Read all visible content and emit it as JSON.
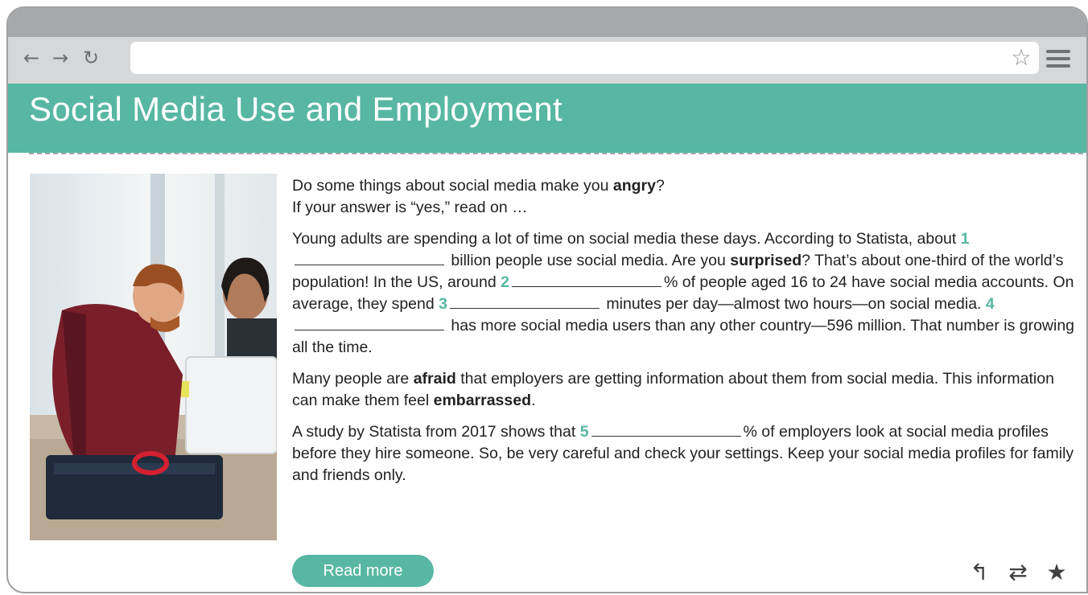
{
  "browser": {
    "back_icon": "←",
    "forward_icon": "→",
    "reload_icon": "↻",
    "address_value": "",
    "bookmark_icon": "☆"
  },
  "page": {
    "title": "Social Media Use and Employment",
    "accent_color": "#57b7a2"
  },
  "article": {
    "intro_pre": "Do some things about social media make you ",
    "intro_bold": "angry",
    "intro_post": "?",
    "intro_line2": "If your answer is “yes,” read on …",
    "p2_a": "Young adults are spending a lot of time on social media these days. According to Statista, about ",
    "num1": "1",
    "p2_b": " billion people use social media. Are you ",
    "p2_bold_surprised": "surprised",
    "p2_c": "? That’s about one-third of the world’s population! In the US, around ",
    "num2": "2",
    "p2_d": "% of people aged 16 to 24 have social media accounts. On average, they spend ",
    "num3": "3",
    "p2_e": " minutes per day—almost two hours—on social media. ",
    "num4": "4",
    "p2_f": " has more social media users than any other country—596 million. That number is growing all the time.",
    "p3_a": "Many people are ",
    "p3_bold_afraid": "afraid",
    "p3_b": " that employers are getting information about them from social media. This information can make them feel ",
    "p3_bold_embarrassed": "embarrassed",
    "p3_c": ".",
    "p4_a": "A study by Statista from 2017 shows that ",
    "num5": "5",
    "p4_b": "% of employers look at social media profiles before they hire someone. So, be very careful and check your settings. Keep your social media profiles for family and friends only."
  },
  "buttons": {
    "read_more": "Read more"
  },
  "actions": {
    "reply_icon": "↰",
    "share_icon": "⇄",
    "favorite_icon": "★"
  }
}
